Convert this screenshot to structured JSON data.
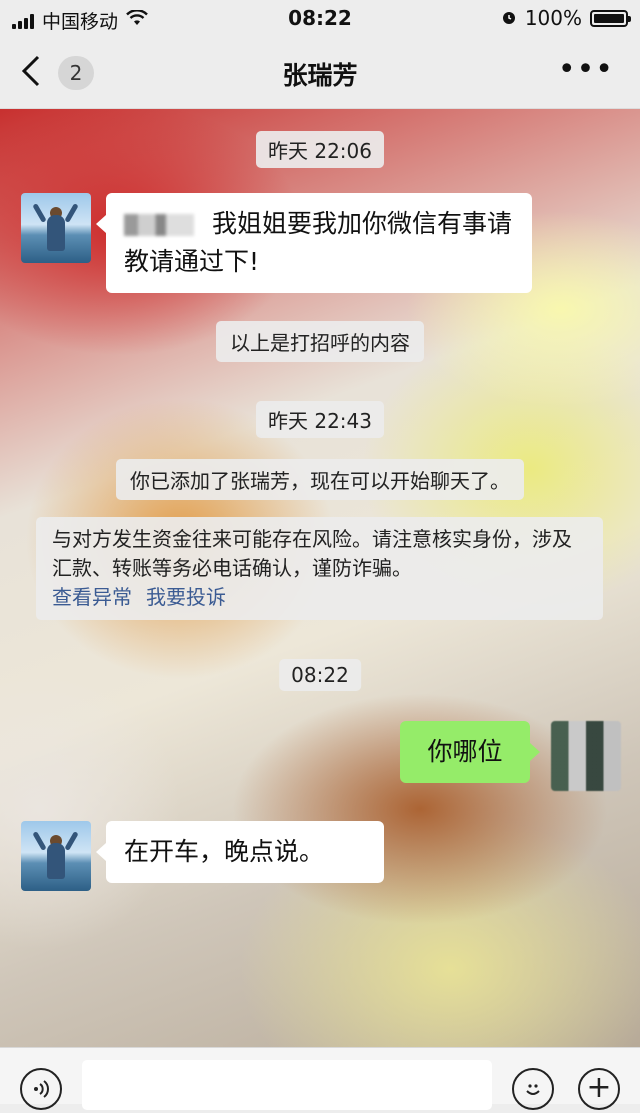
{
  "status_bar": {
    "carrier": "中国移动",
    "time": "08:22",
    "battery": "100%",
    "battery_level": 1.0
  },
  "nav": {
    "unread_count": "2",
    "title": "张瑞芳"
  },
  "messages": {
    "time_1": "昨天 22:06",
    "friend_request": "我姐姐要我加你微信有事请教请通过下!",
    "greeting_note": "以上是打招呼的内容",
    "time_2": "昨天 22:43",
    "added_note": "你已添加了张瑞芳，现在可以开始聊天了。",
    "risk_notice": "与对方发生资金往来可能存在风险。请注意核实身份，涉及汇款、转账等务必电话确认，谨防诈骗。",
    "link_check": "查看异常",
    "link_report": "我要投诉",
    "time_3": "08:22",
    "my_message": "你哪位",
    "reply": "在开车，晚点说。"
  },
  "icons": {
    "back": "chevron-left-icon",
    "more": "ellipsis-icon",
    "voice": "voice-icon",
    "emoji": "emoji-icon",
    "plus": "plus-icon"
  },
  "colors": {
    "my_bubble": "#95ec69",
    "other_bubble": "#ffffff",
    "link": "#3b5b93"
  }
}
